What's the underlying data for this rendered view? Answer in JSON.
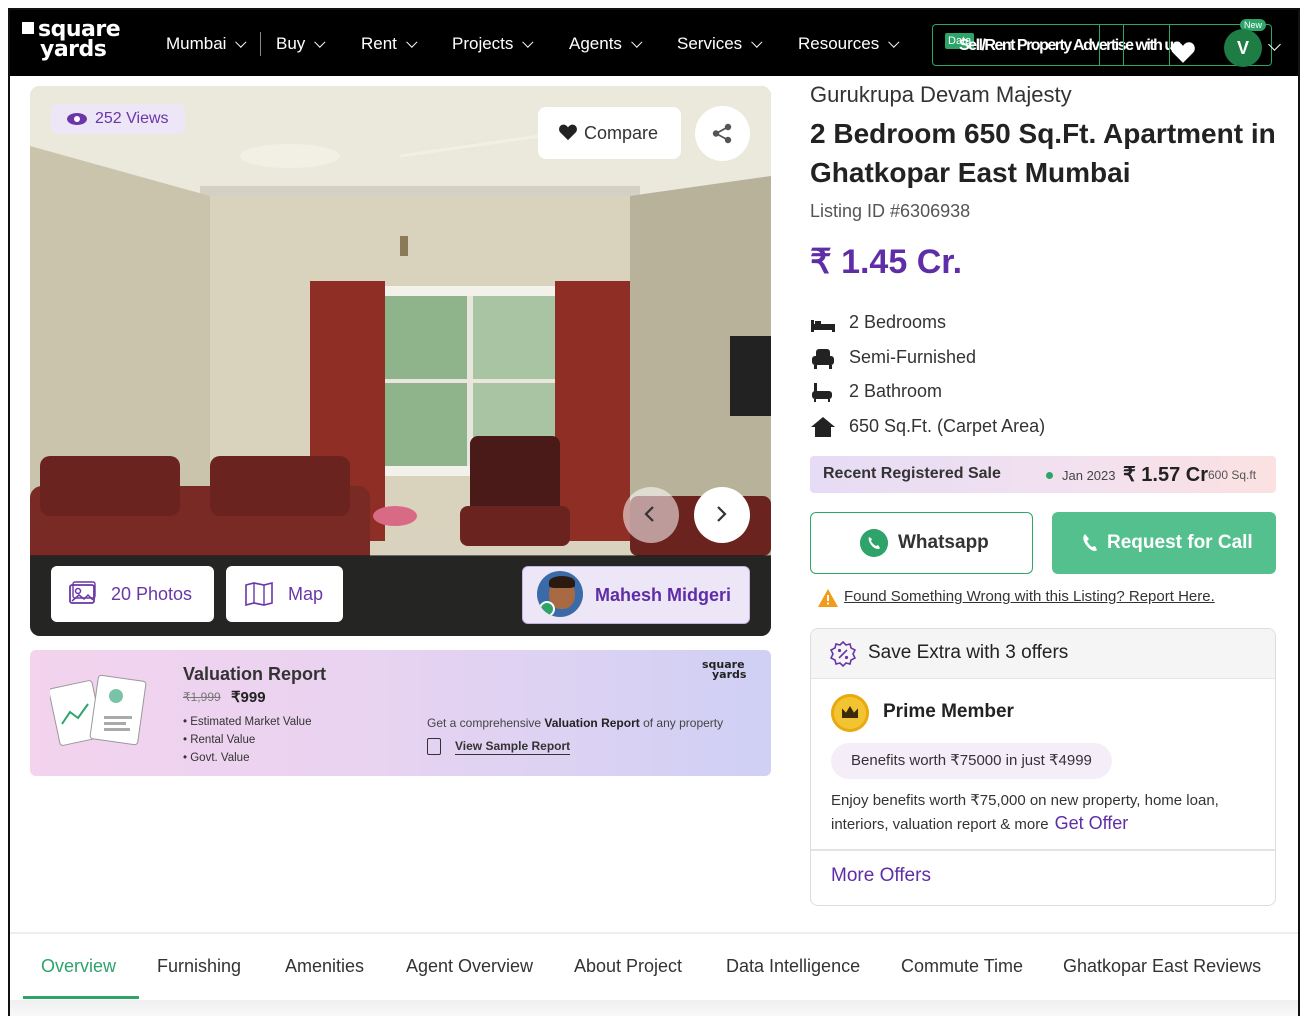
{
  "header": {
    "logo_line1": "square",
    "logo_line2": "yards",
    "city": "Mumbai",
    "nav": [
      "Buy",
      "Rent",
      "Projects",
      "Agents",
      "Services",
      "Resources"
    ],
    "right_cluster_text": "Sell/Rent Property  Advertise with us",
    "data_tag": "Data",
    "new_tag": "New",
    "avatar_letter": "V"
  },
  "gallery": {
    "views": "252 Views",
    "compare": "Compare",
    "photos": "20 Photos",
    "map": "Map",
    "agent_name": "Mahesh Midgeri"
  },
  "valuation": {
    "title": "Valuation Report",
    "old_price": "₹1,999",
    "new_price": "₹999",
    "bullets": [
      "Estimated Market Value",
      "Rental Value",
      "Govt. Value"
    ],
    "desc_pre": "Get a comprehensive ",
    "desc_bold": "Valuation Report",
    "desc_post": " of any property",
    "link": "View Sample Report",
    "brand_line1": "square",
    "brand_line2": "yards"
  },
  "property": {
    "project": "Gurukrupa Devam Majesty",
    "title": "2 Bedroom 650 Sq.Ft. Apartment in Ghatkopar East Mumbai",
    "listing_id": "Listing ID #6306938",
    "price": "₹ 1.45 Cr.",
    "specs": [
      "2 Bedrooms",
      "Semi-Furnished",
      "2 Bathroom",
      "650 Sq.Ft. (Carpet Area)"
    ]
  },
  "recent_sale": {
    "label": "Recent Registered Sale",
    "date": "Jan 2023",
    "amount": "₹ 1.57 Cr",
    "size": "600 Sq.ft"
  },
  "actions": {
    "whatsapp": "Whatsapp",
    "call": "Request for Call",
    "report": "Found Something Wrong with this Listing? Report Here."
  },
  "offers": {
    "header": "Save Extra with 3 offers",
    "prime_title": "Prime Member",
    "benefit": "Benefits worth ₹75000 in just ₹4999",
    "enjoy_text": "Enjoy benefits worth ₹75,000 on new property, home loan, interiors, valuation report & more",
    "get_offer": "Get Offer",
    "more": "More Offers"
  },
  "tabs": [
    "Overview",
    "Furnishing",
    "Amenities",
    "Agent Overview",
    "About Project",
    "Data Intelligence",
    "Commute Time",
    "Ghatkopar East Reviews"
  ],
  "colors": {
    "brand_purple": "#5f2ea6",
    "brand_green": "#2ea36a",
    "call_green": "#54c08e"
  }
}
